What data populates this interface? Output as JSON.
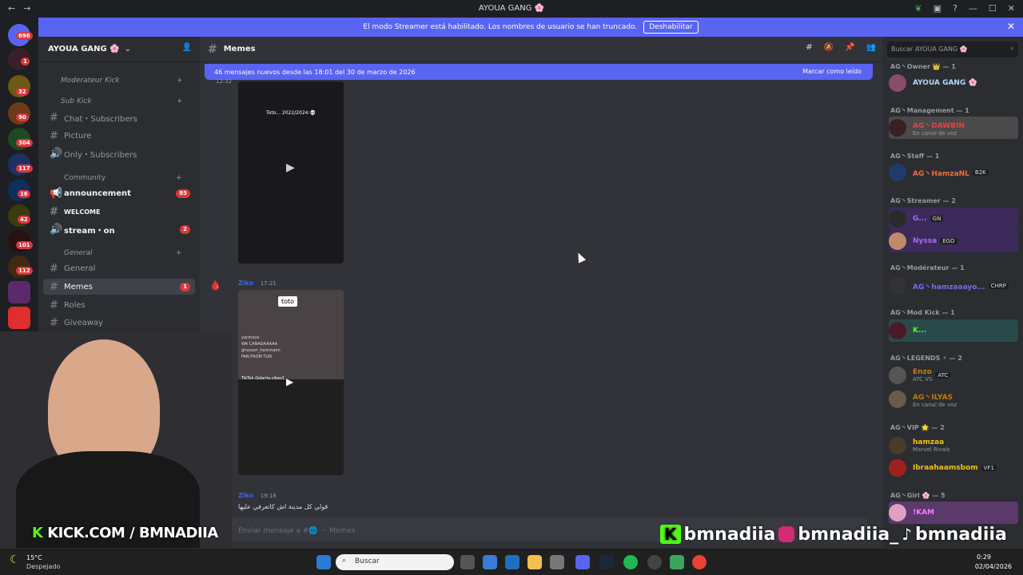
{
  "window": {
    "title": "AYOUA GANG 🌸"
  },
  "banner": {
    "text": "El modo Streamer está habilitado. Los nombres de usuario se han truncado.",
    "button": "Deshabilitar"
  },
  "guilds": {
    "badges": [
      "698",
      "1",
      "32",
      "90",
      "304",
      "117",
      "16",
      "42",
      "101",
      "112"
    ]
  },
  "server": {
    "name": "AYOUA GANG 🌸"
  },
  "sidebar": {
    "categories": [
      "Moderateur Kick",
      "Sub Kick",
      "Community",
      "General"
    ],
    "channels": [
      {
        "label": "Chat・Subscribers"
      },
      {
        "label": "Picture"
      },
      {
        "label": "Only・Subscribers"
      },
      {
        "label": "announcement",
        "count": "85"
      },
      {
        "label": "WELCOME"
      },
      {
        "label": "stream・on",
        "count": "2"
      },
      {
        "label": "General"
      },
      {
        "label": "Memes",
        "count": "1"
      },
      {
        "label": "Roles"
      },
      {
        "label": "Giveaway"
      }
    ]
  },
  "channel": {
    "name": "Memes"
  },
  "new_messages": {
    "text": "46 mensajes nuevos desde las 18:01 del 30 de marzo de 2026",
    "action": "Marcar como leído"
  },
  "messages": [
    {
      "time_top": "12:32",
      "video_caption": "Toto... 2022/2024:💀"
    },
    {
      "author": "Ziko",
      "time": "17:21",
      "label": "toto",
      "lines": [
        "yacinoux",
        "WA CANADAAAAA",
        "ghassen_hammami",
        "FAN FROM TUN"
      ],
      "tiktok": "TikTok @darija.vibes1"
    },
    {
      "author": "Ziko",
      "time": "19:18",
      "text": "قولي كل مدينة اش كاتعرفي عليها"
    }
  ],
  "composer": {
    "placeholder": "Enviar mensaje a #🌐 ・ Memes"
  },
  "search": {
    "placeholder": "Buscar AYOUA GANG 🌸"
  },
  "members": {
    "groups": [
      {
        "role": "AG丶Owner 👑 — 1",
        "items": [
          {
            "name": "AYOUA GANG 🌸",
            "color": "#b7d7f7"
          }
        ]
      },
      {
        "role": "AG丶Management — 1",
        "items": [
          {
            "name": "AG丶DAWBIN",
            "color": "#e84040",
            "sub": "En canal de voz"
          }
        ]
      },
      {
        "role": "AG丶Staff — 1",
        "items": [
          {
            "name": "AG丶HamzaNL",
            "color": "#f0703c",
            "tag": "B2K"
          }
        ]
      },
      {
        "role": "AG丶Streamer — 2",
        "items": [
          {
            "name": "G...",
            "color": "#a36bf5",
            "tag": "GN"
          },
          {
            "name": "Nyssa",
            "color": "#a36bf5",
            "tag": "EGO"
          }
        ]
      },
      {
        "role": "AG丶Modérateur — 1",
        "items": [
          {
            "name": "AG丶hamzaaayo...",
            "color": "#7b68ee",
            "tag": "CHRP"
          }
        ]
      },
      {
        "role": "AG丶Mod Kick — 1",
        "items": [
          {
            "name": "K...",
            "color": "#53fc18"
          }
        ]
      },
      {
        "role": "AG丶LEGENDS ⚡ — 2",
        "items": [
          {
            "name": "Enzo",
            "color": "#c27c0e",
            "sub": "ATC VS",
            "tag": "ATC"
          },
          {
            "name": "AG丶ILYAS",
            "color": "#c27c0e",
            "sub": "En canal de voz"
          }
        ]
      },
      {
        "role": "AG丶VIP 🌟 — 2",
        "items": [
          {
            "name": "hamzaa",
            "color": "#f1c40f",
            "sub": "Marvel Rivals"
          },
          {
            "name": "Ibraahaamsbom",
            "color": "#f1c40f",
            "tag": "VF1"
          }
        ]
      },
      {
        "role": "AG丶Girl 🌸 — 5",
        "items": [
          {
            "name": "!KAM",
            "color": "#f47fff"
          }
        ]
      }
    ]
  },
  "overlay": {
    "left": "KICK.COM / BMNADIIA",
    "right": [
      "bmnadiia",
      "bmnadiia_",
      "bmnadiia"
    ]
  },
  "taskbar": {
    "weather": "15°C",
    "weather_desc": "Despejado",
    "search": "Buscar",
    "time": "0:29",
    "date": "02/04/2026"
  }
}
